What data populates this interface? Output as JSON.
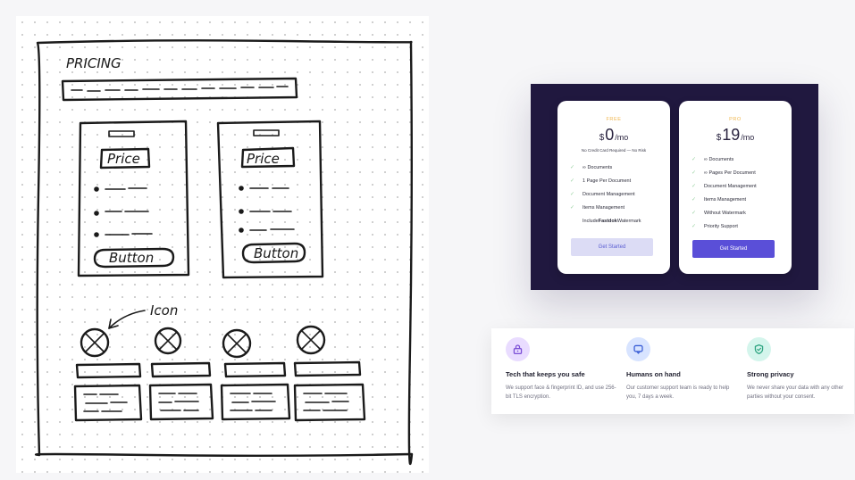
{
  "sketch": {
    "title": "PRICING",
    "cards": [
      {
        "price_label": "Price",
        "button_label": "Button"
      },
      {
        "price_label": "Price",
        "button_label": "Button"
      }
    ],
    "annotation": "Icon"
  },
  "pricing": {
    "plans": [
      {
        "tier": "FREE",
        "currency": "$",
        "amount": "0",
        "period": "/mo",
        "note": "No Credit Card Required — No Risk",
        "features": [
          {
            "text": "∞ Documents",
            "check": true
          },
          {
            "text": "1 Page Per Document",
            "check": true
          },
          {
            "text": "Document Management",
            "check": true
          },
          {
            "text": "Items Management",
            "check": true
          },
          {
            "text_prefix": "Include ",
            "text_bold": "Fastdok",
            "text_suffix": " Watermark",
            "check": false
          }
        ],
        "cta_label": "Get Started"
      },
      {
        "tier": "PRO",
        "currency": "$",
        "amount": "19",
        "period": "/mo",
        "features": [
          {
            "text": "∞ Documents",
            "check": true
          },
          {
            "text": "∞ Pages Per Document",
            "check": true
          },
          {
            "text": "Document Management",
            "check": true
          },
          {
            "text": "Items Management",
            "check": true
          },
          {
            "text": "Without Watermark",
            "check": true
          },
          {
            "text": "Priority Support",
            "check": true
          }
        ],
        "cta_label": "Get Started"
      }
    ]
  },
  "benefits": [
    {
      "icon": "lock-icon",
      "icon_bg": "#e9dcff",
      "icon_color": "#7b4fd6",
      "title": "Tech that keeps you safe",
      "description": "We support face & fingerprint ID, and use 256-bit TLS encryption."
    },
    {
      "icon": "chat-icon",
      "icon_bg": "#d8e4ff",
      "icon_color": "#3b5fd6",
      "title": "Humans on hand",
      "description": "Our customer support team is ready to help you, 7 days a week."
    },
    {
      "icon": "shield-icon",
      "icon_bg": "#d4f5ec",
      "icon_color": "#2fa582",
      "title": "Strong privacy",
      "description": "We never share your data with any other parties without your consent."
    }
  ]
}
